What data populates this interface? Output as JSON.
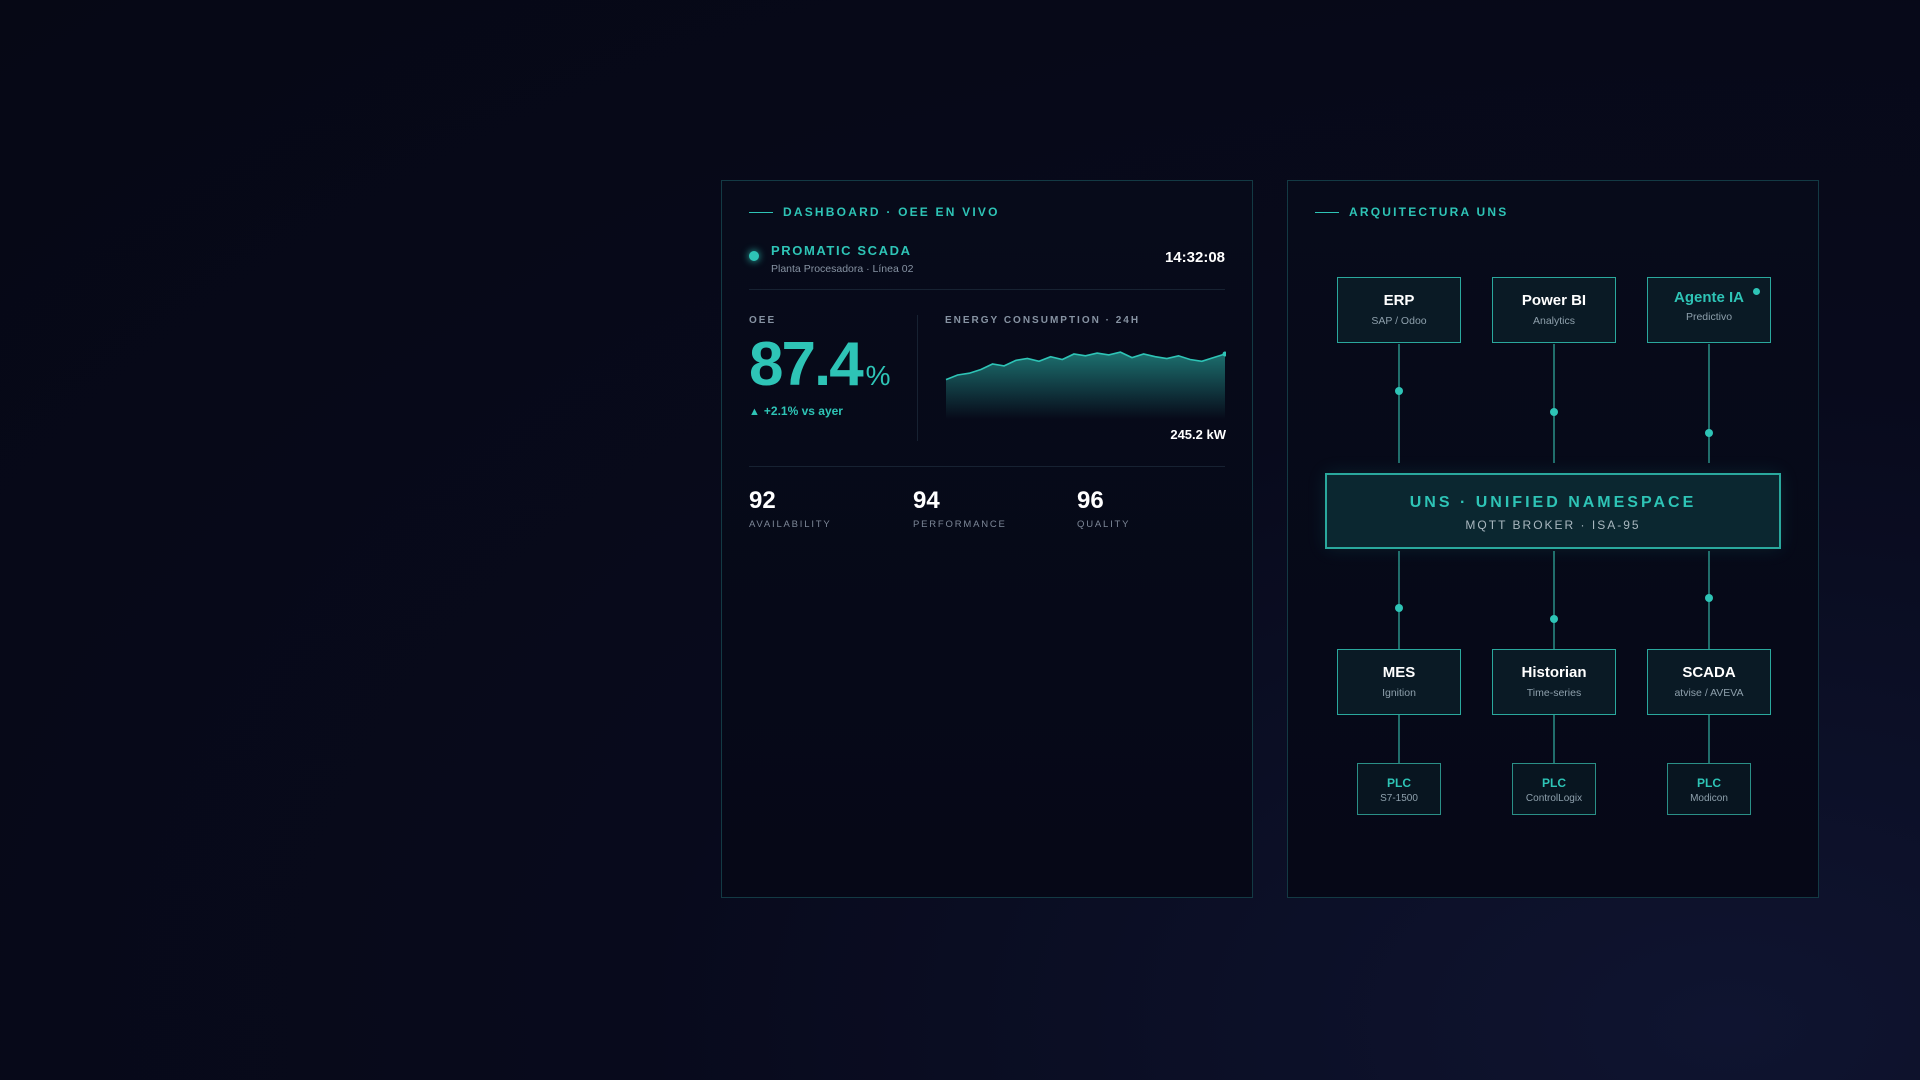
{
  "dashboard": {
    "title": "DASHBOARD · OEE EN VIVO",
    "system_name": "PROMATIC SCADA",
    "system_location": "Planta Procesadora · Línea 02",
    "clock": "14:32:08",
    "oee": {
      "label": "OEE",
      "value": "87.4",
      "unit": "%",
      "delta_icon": "triangle-up-icon",
      "delta": "+2.1% vs ayer"
    },
    "energy": {
      "label": "ENERGY CONSUMPTION · 24H",
      "current": "245.2 kW"
    },
    "kpis": [
      {
        "value": "92",
        "label": "AVAILABILITY"
      },
      {
        "value": "94",
        "label": "PERFORMANCE"
      },
      {
        "value": "96",
        "label": "QUALITY"
      }
    ]
  },
  "chart_data": {
    "type": "area",
    "title": "ENERGY CONSUMPTION · 24H",
    "xlabel": "",
    "ylabel": "",
    "x": [
      0,
      1,
      2,
      3,
      4,
      5,
      6,
      7,
      8,
      9,
      10,
      11,
      12,
      13,
      14,
      15,
      16,
      17,
      18,
      19,
      20,
      21,
      22,
      23,
      24
    ],
    "values": [
      30,
      35,
      37,
      41,
      47,
      45,
      51,
      53,
      50,
      55,
      52,
      58,
      56,
      59,
      57,
      60,
      54,
      58,
      55,
      53,
      56,
      52,
      50,
      54,
      58
    ],
    "ylim": [
      0,
      70
    ],
    "grid": false,
    "legend": "none",
    "color": "#2ec4b6"
  },
  "architecture": {
    "title": "ARQUITECTURA UNS",
    "top_nodes": [
      {
        "title": "ERP",
        "sub": "SAP / Odoo"
      },
      {
        "title": "Power BI",
        "sub": "Analytics"
      },
      {
        "title": "Agente IA",
        "sub": "Predictivo"
      }
    ],
    "uns": {
      "title": "UNS · UNIFIED NAMESPACE",
      "sub": "MQTT BROKER · ISA-95"
    },
    "bottom_nodes": [
      {
        "title": "MES",
        "sub": "Ignition"
      },
      {
        "title": "Historian",
        "sub": "Time-series"
      },
      {
        "title": "SCADA",
        "sub": "atvise / AVEVA"
      }
    ],
    "plcs": [
      {
        "title": "PLC",
        "sub": "S7-1500"
      },
      {
        "title": "PLC",
        "sub": "ControlLogix"
      },
      {
        "title": "PLC",
        "sub": "Modicon"
      }
    ]
  },
  "colors": {
    "accent": "#2ec4b6",
    "background": "#070b1a",
    "border": "#133a44"
  }
}
